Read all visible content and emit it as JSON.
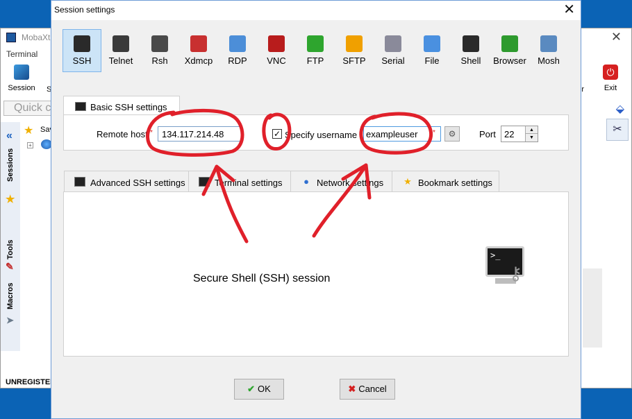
{
  "background_app": {
    "title": "MobaXt",
    "menu_label": "Terminal",
    "session_label": "Session",
    "s_label": "S",
    "exit_label": "Exit",
    "er_label": "er",
    "quick_connect_placeholder": "Quick c",
    "side_tabs": [
      "Sessions",
      "Tools",
      "Macros"
    ],
    "tree_saved_label": "Sav",
    "unregistered_label": "UNREGISTER"
  },
  "dialog": {
    "title": "Session settings",
    "close_glyph": "✕"
  },
  "session_types": [
    {
      "label": "SSH",
      "icon": "ssh-icon",
      "color": "#2a2a2a",
      "selected": true
    },
    {
      "label": "Telnet",
      "icon": "telnet-icon",
      "color": "#3a3a3a"
    },
    {
      "label": "Rsh",
      "icon": "rsh-icon",
      "color": "#4a4a4a"
    },
    {
      "label": "Xdmcp",
      "icon": "xdmcp-icon",
      "color": "#c83030"
    },
    {
      "label": "RDP",
      "icon": "rdp-icon",
      "color": "#4c8ed8"
    },
    {
      "label": "VNC",
      "icon": "vnc-icon",
      "color": "#b81c1c"
    },
    {
      "label": "FTP",
      "icon": "ftp-icon",
      "color": "#2ea52e"
    },
    {
      "label": "SFTP",
      "icon": "sftp-icon",
      "color": "#f0a000"
    },
    {
      "label": "Serial",
      "icon": "serial-icon",
      "color": "#8a8a9a"
    },
    {
      "label": "File",
      "icon": "file-icon",
      "color": "#4a90e0"
    },
    {
      "label": "Shell",
      "icon": "shell-icon",
      "color": "#2a2a2a"
    },
    {
      "label": "Browser",
      "icon": "browser-icon",
      "color": "#2e9a2e"
    },
    {
      "label": "Mosh",
      "icon": "mosh-icon",
      "color": "#5a8ac0"
    }
  ],
  "basic": {
    "tab_label": "Basic SSH settings",
    "remote_host_label": "Remote host",
    "remote_host_value": "134.117.214.48",
    "required_mark": "*",
    "specify_username_label": "Specify username",
    "specify_username_checked": "✓",
    "username_value": "exampleuser",
    "port_label": "Port",
    "port_value": "22"
  },
  "advanced_tabs": [
    {
      "label": "Advanced SSH settings",
      "icon": "terminal-icon"
    },
    {
      "label": "Terminal settings",
      "icon": "terminal-icon"
    },
    {
      "label": "Network settings",
      "icon": "globe-icon"
    },
    {
      "label": "Bookmark settings",
      "icon": "star-icon"
    }
  ],
  "panel_description": "Secure Shell (SSH) session",
  "buttons": {
    "ok_label": "OK",
    "cancel_label": "Cancel"
  },
  "colors": {
    "annotation": "#e0202a",
    "selection": "#cce4f7",
    "desktop": "#0b63b5"
  }
}
